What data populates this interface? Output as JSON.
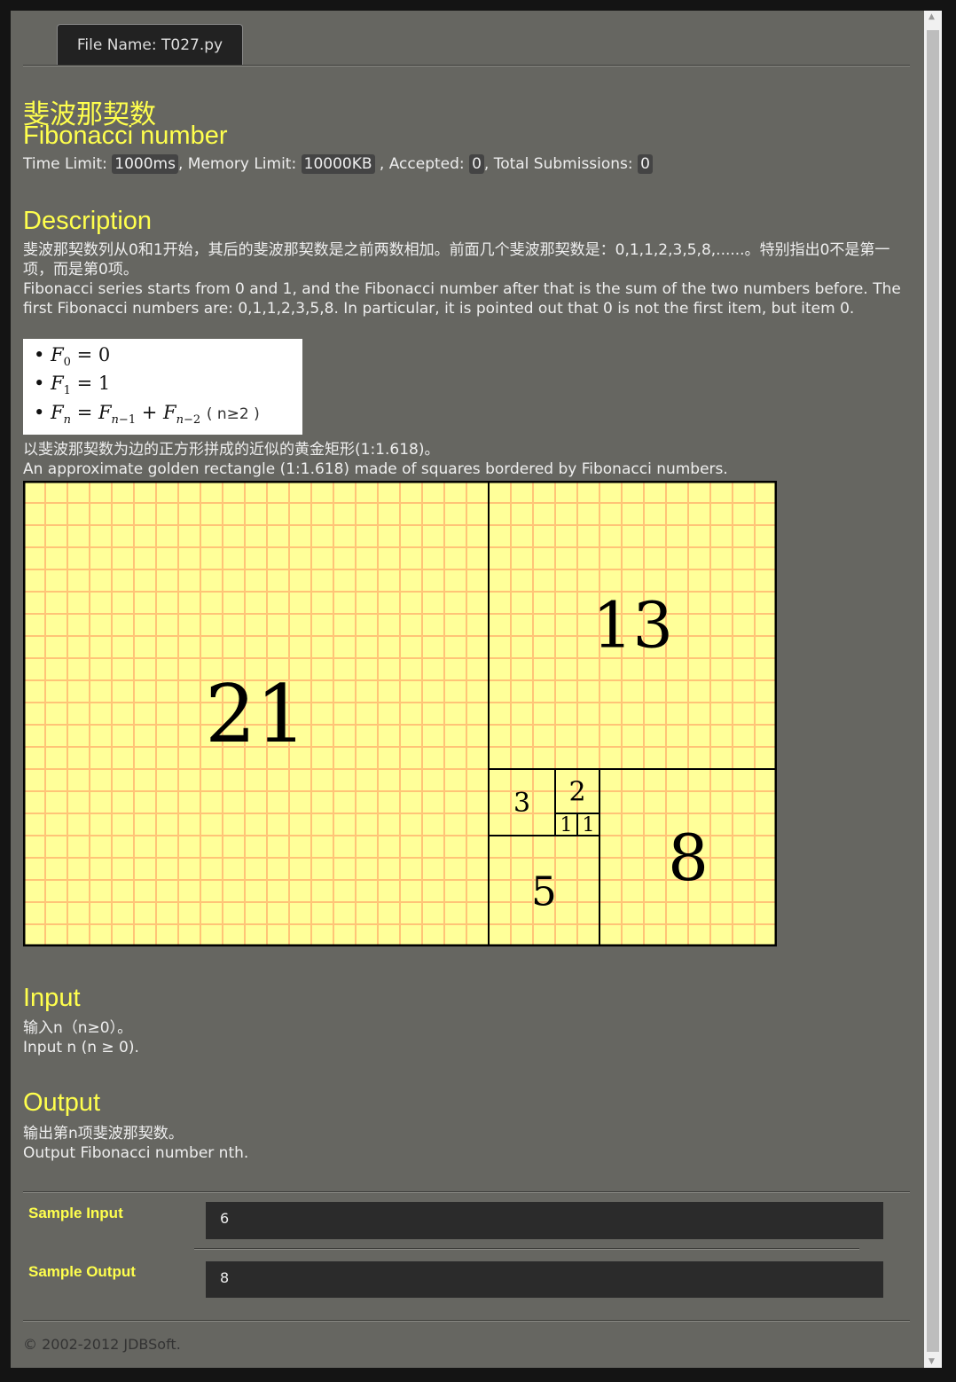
{
  "tab": {
    "file_label": "File Name:",
    "file_name": "T027.py"
  },
  "title": {
    "zh": "斐波那契数",
    "en": "Fibonacci number"
  },
  "limits": {
    "time_label": "Time Limit:",
    "time": "1000ms",
    "mem_label": ", Memory Limit:",
    "mem": "10000KB",
    "acc_label": ", Accepted:",
    "acc": "0",
    "total_label": ", Total Submissions:",
    "total": "0"
  },
  "description": {
    "heading": "Description",
    "zh": "斐波那契数列从0和1开始，其后的斐波那契数是之前两数相加。前面几个斐波那契数是：0,1,1,2,3,5,8,......。特别指出0不是第一项，而是第0项。",
    "en": "Fibonacci series starts from 0 and 1, and the Fibonacci number after that is the sum of the two numbers before. The first Fibonacci numbers are: 0,1,1,2,3,5,8. In particular, it is pointed out that 0 is not the first item, but item 0.",
    "condition": "( n≥2 )",
    "caption_zh": "以斐波那契数为边的正方形拼成的近似的黄金矩形(1:1.618)。",
    "caption_en": "An approximate golden rectangle (1:1.618) made of squares bordered by Fibonacci numbers.",
    "squares": [
      "21",
      "13",
      "8",
      "5",
      "3",
      "2",
      "1",
      "1"
    ]
  },
  "input": {
    "heading": "Input",
    "zh": "输入n（n≥0）。",
    "en": "Input n (n ≥ 0)."
  },
  "output": {
    "heading": "Output",
    "zh": "输出第n项斐波那契数。",
    "en": "Output Fibonacci number nth."
  },
  "samples": {
    "input_label": "Sample Input",
    "input": "6",
    "output_label": "Sample Output",
    "output": "8"
  },
  "footer": "© 2002-2012  JDBSoft."
}
